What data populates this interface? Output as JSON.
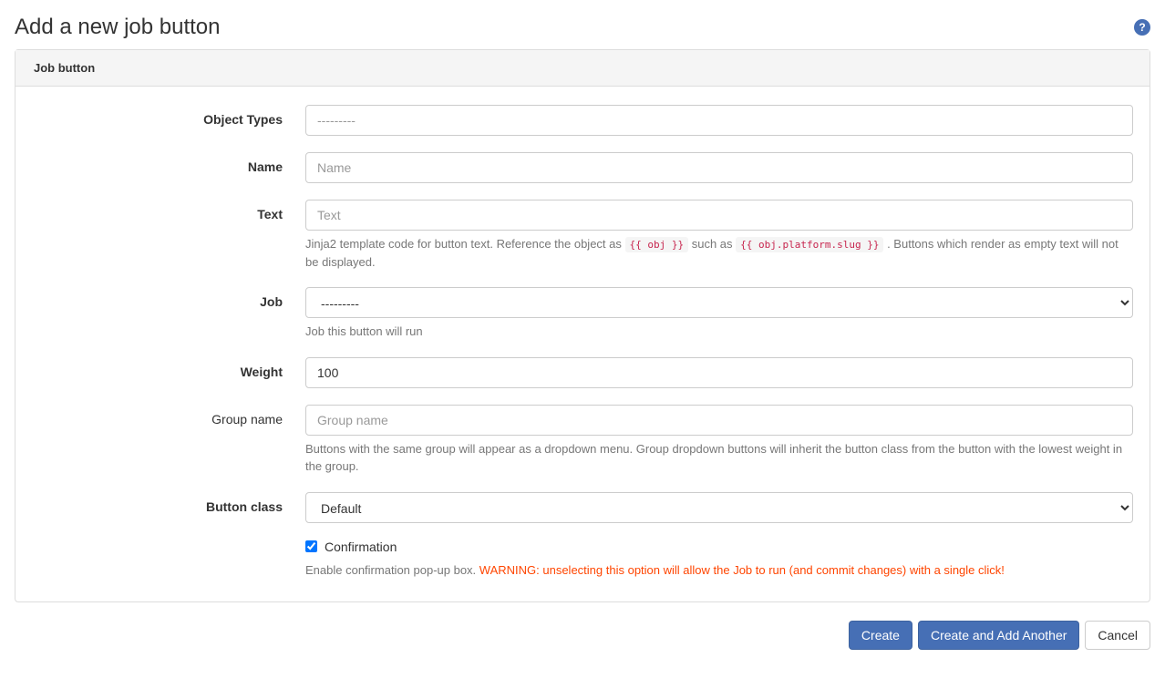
{
  "page_title": "Add a new job button",
  "panel_title": "Job button",
  "fields": {
    "object_types": {
      "label": "Object Types",
      "placeholder": "---------",
      "value": ""
    },
    "name": {
      "label": "Name",
      "placeholder": "Name",
      "value": ""
    },
    "text": {
      "label": "Text",
      "placeholder": "Text",
      "value": "",
      "help_pre": "Jinja2 template code for button text. Reference the object as ",
      "help_code1": "{{ obj }}",
      "help_mid": " such as ",
      "help_code2": "{{ obj.platform.slug }}",
      "help_post": " . Buttons which render as empty text will not be displayed."
    },
    "job": {
      "label": "Job",
      "selected": "---------",
      "help": "Job this button will run"
    },
    "weight": {
      "label": "Weight",
      "value": "100"
    },
    "group_name": {
      "label": "Group name",
      "placeholder": "Group name",
      "value": "",
      "help": "Buttons with the same group will appear as a dropdown menu. Group dropdown buttons will inherit the button class from the button with the lowest weight in the group."
    },
    "button_class": {
      "label": "Button class",
      "selected": "Default"
    },
    "confirmation": {
      "label": "Confirmation",
      "checked": true,
      "help_pre": "Enable confirmation pop-up box. ",
      "help_warning": "WARNING: unselecting this option will allow the Job to run (and commit changes) with a single click!"
    }
  },
  "buttons": {
    "create": "Create",
    "create_another": "Create and Add Another",
    "cancel": "Cancel"
  },
  "help_icon_glyph": "?"
}
